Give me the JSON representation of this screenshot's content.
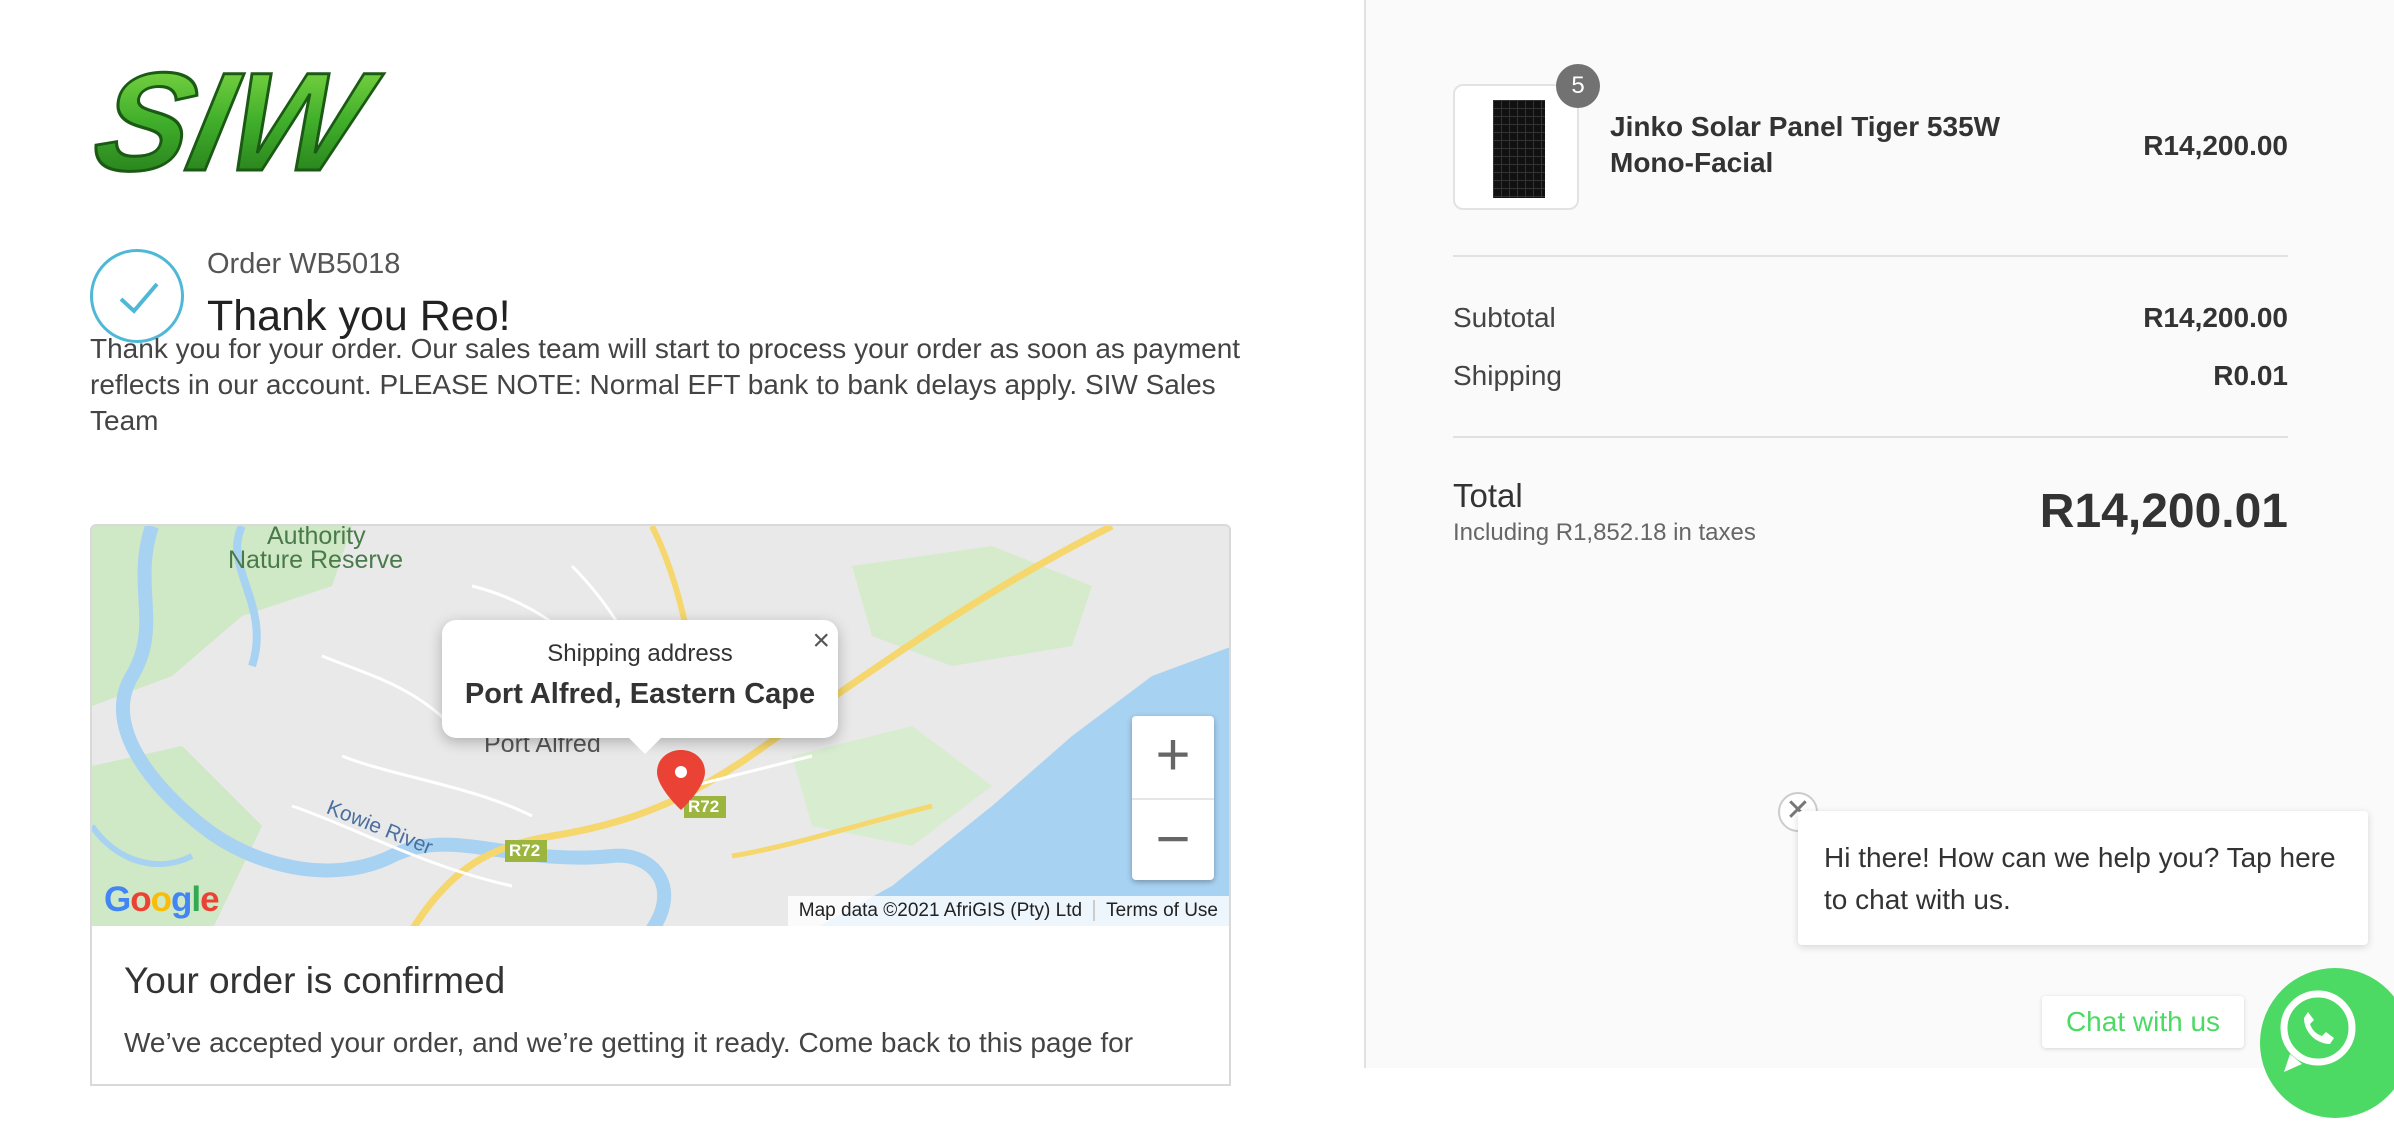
{
  "brand": {
    "logo_text": "SIW"
  },
  "order": {
    "number": "Order WB5018",
    "thanks": "Thank you Reo!",
    "message": "Thank you for your order. Our sales team will start to process your order as soon as payment reflects in our account. PLEASE NOTE: Normal EFT bank to bank delays apply. SIW Sales Team"
  },
  "map": {
    "popup_label": "Shipping address",
    "popup_address": "Port Alfred, Eastern Cape",
    "zoom_in": "+",
    "zoom_out": "−",
    "attribution": "Map data ©2021 AfriGIS (Pty) Ltd",
    "terms": "Terms of Use",
    "google": "Google",
    "places": {
      "reserve_1": "Authority",
      "reserve_2": "Nature Reserve",
      "town": "Port Alfred",
      "river": "Kowie River",
      "road_1": "R72",
      "road_2": "R72"
    }
  },
  "confirmation": {
    "title": "Your order is confirmed",
    "text": "We’ve accepted your order, and we’re getting it ready. Come back to this page for"
  },
  "cart": {
    "item": {
      "name": "Jinko Solar Panel Tiger 535W Mono-Facial",
      "price": "R14,200.00",
      "quantity": "5"
    },
    "subtotal_label": "Subtotal",
    "subtotal_value": "R14,200.00",
    "shipping_label": "Shipping",
    "shipping_value": "R0.01",
    "total_label": "Total",
    "tax_note": "Including R1,852.18 in taxes",
    "total_value": "R14,200.01"
  },
  "chat": {
    "message": "Hi there! How can we help you? Tap here to chat with us.",
    "button": "Chat with us",
    "close": "✕"
  },
  "colors": {
    "accent_check": "#4fb8d6",
    "whatsapp": "#4cd964",
    "logo_green": "#3fae2a"
  }
}
